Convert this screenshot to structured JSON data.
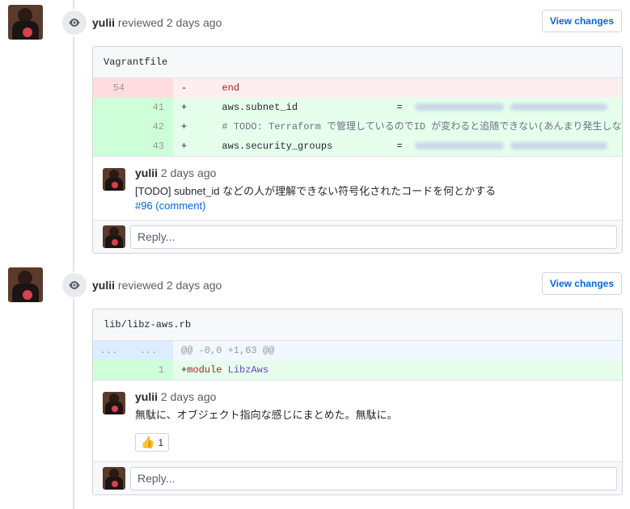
{
  "reviews": [
    {
      "reviewer": "yulii",
      "action": "reviewed 2 days ago",
      "view_changes": "View changes",
      "file": "Vagrantfile",
      "lines": [
        {
          "old": "54",
          "new": "",
          "sign": "-",
          "text": "      end"
        },
        {
          "old": "",
          "new": "41",
          "sign": "+",
          "text": "      aws.subnet_id                 = "
        },
        {
          "old": "",
          "new": "42",
          "sign": "+",
          "text": "      # TODO: Terraform で管理しているのでID が変わると追随できない(あんまり発生しないと思"
        },
        {
          "old": "",
          "new": "43",
          "sign": "+",
          "text": "      aws.security_groups           = "
        }
      ],
      "comment": {
        "author": "yulii",
        "time": "2 days ago",
        "body": "[TODO] subnet_id などの人が理解できない符号化されたコードを何とかする",
        "link": "#96 (comment)"
      },
      "reply_placeholder": "Reply..."
    },
    {
      "reviewer": "yulii",
      "action": "reviewed 2 days ago",
      "view_changes": "View changes",
      "file": "lib/libz-aws.rb",
      "hunk": {
        "old": "...",
        "new": "...",
        "text": "@@ -0,0 +1,63 @@"
      },
      "lines": [
        {
          "old": "",
          "new": "1",
          "sign": "+",
          "keyword": "module",
          "text": " LibzAws"
        }
      ],
      "comment": {
        "author": "yulii",
        "time": "2 days ago",
        "body": "無駄に、オブジェクト指向な感じにまとめた。無駄に。",
        "reaction_icon": "thumbs-up-icon",
        "reaction_count": "1"
      },
      "reply_placeholder": "Reply..."
    }
  ]
}
